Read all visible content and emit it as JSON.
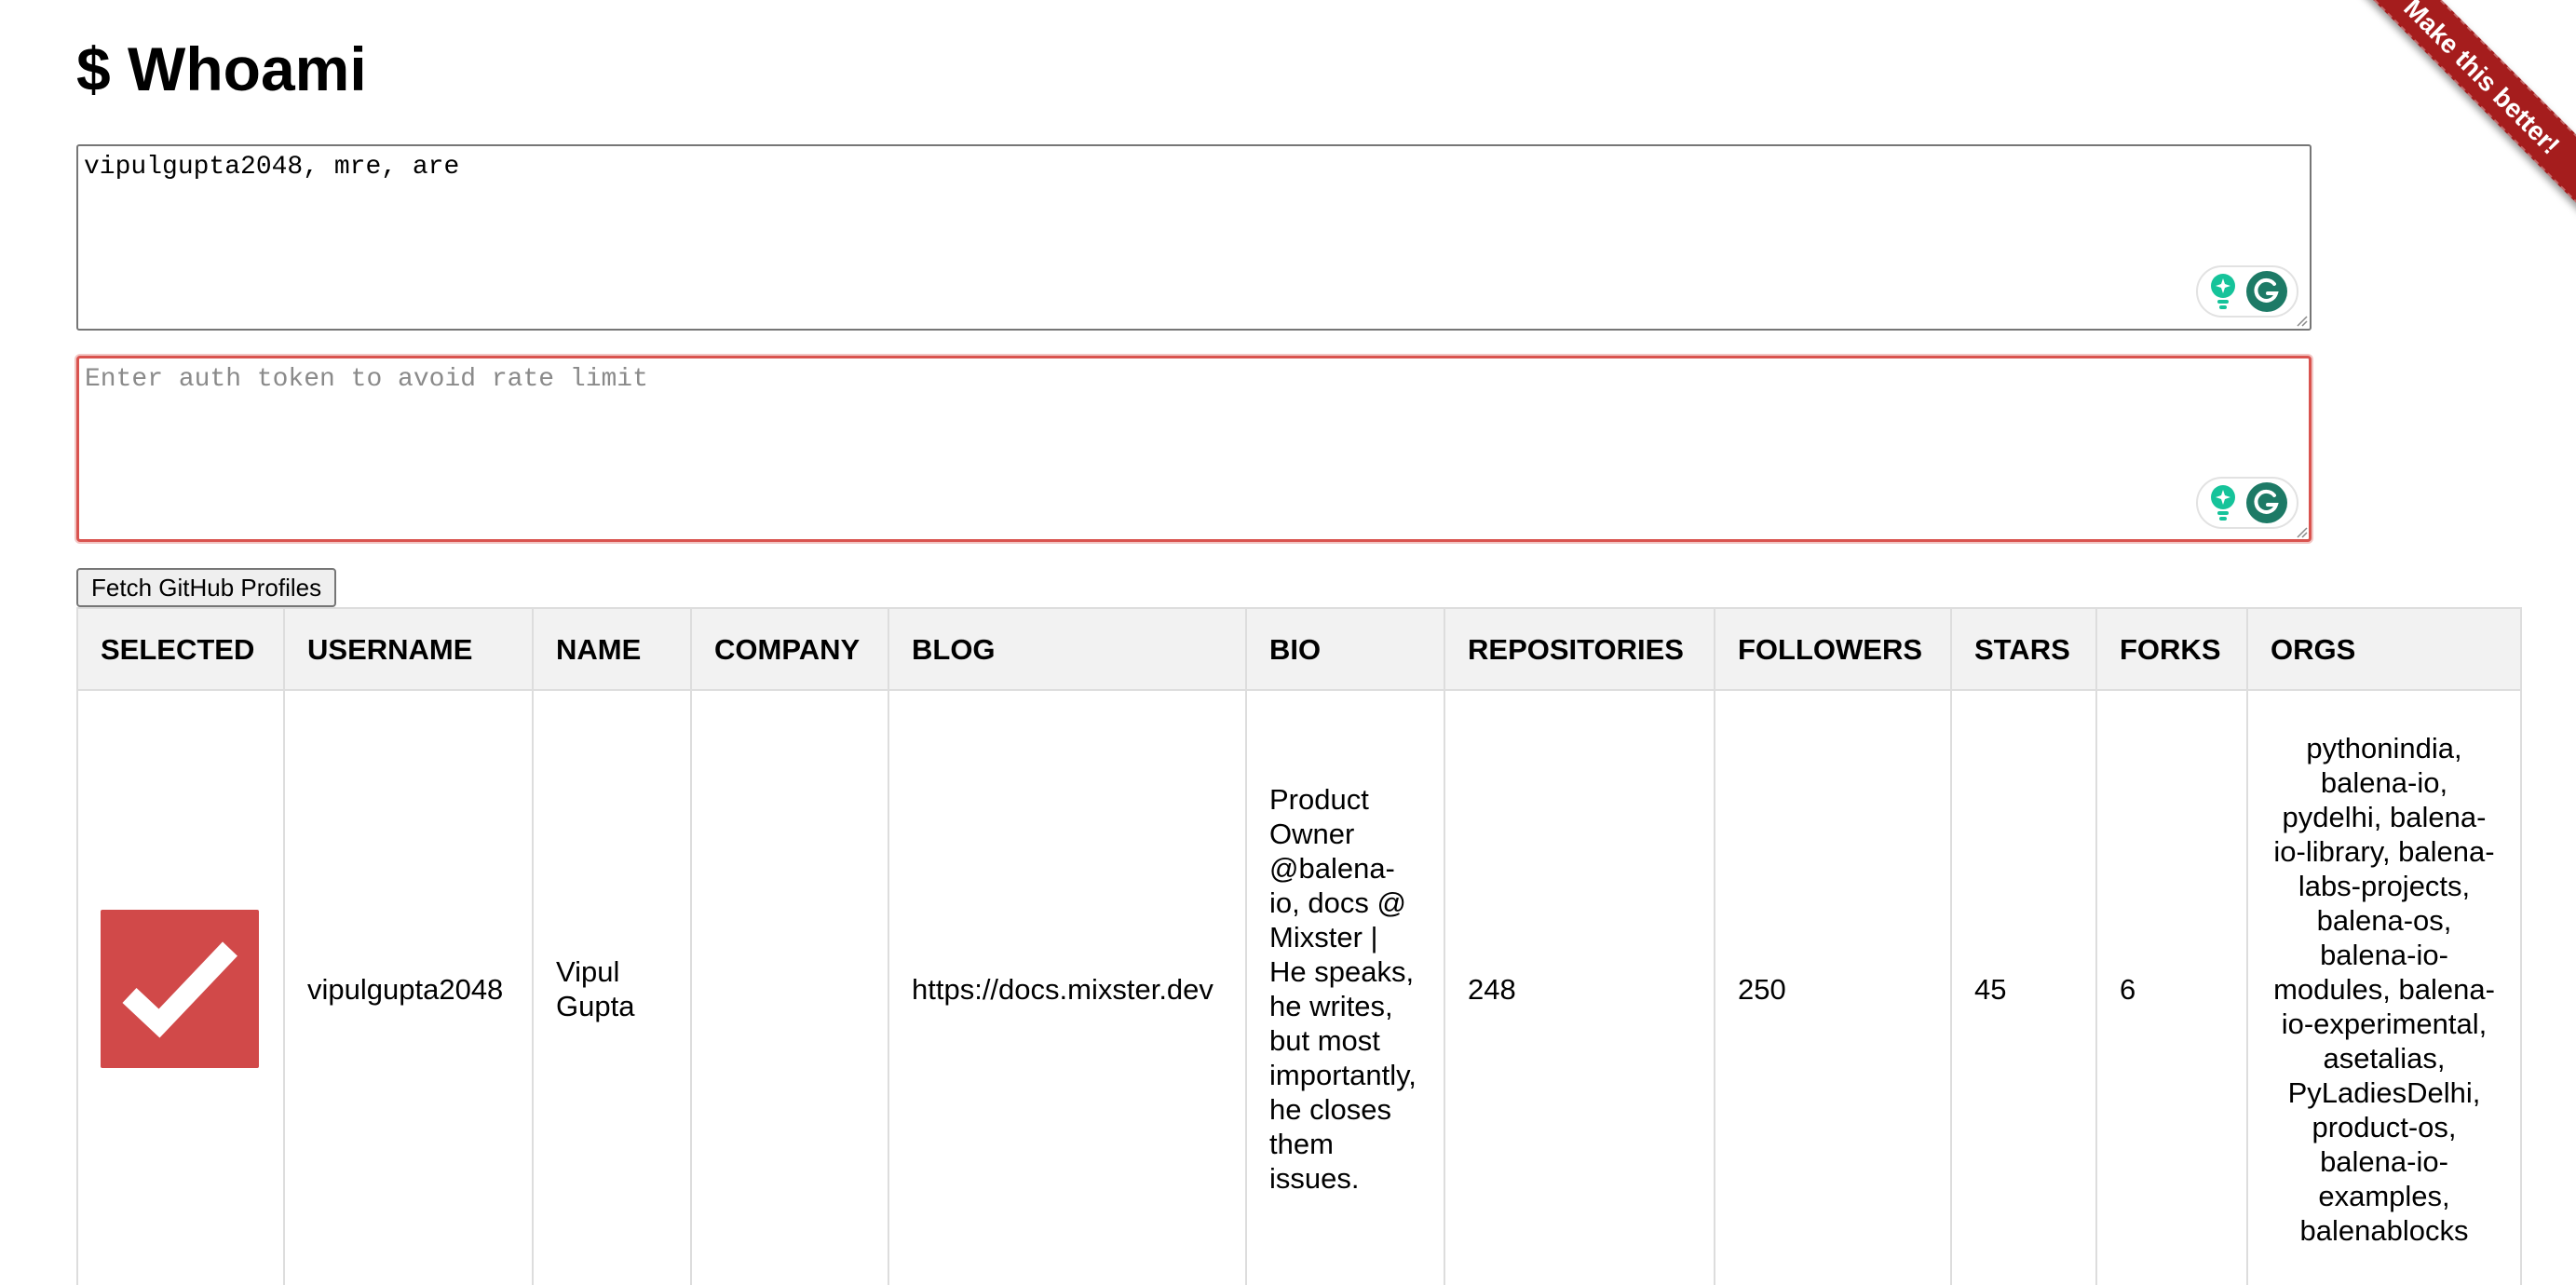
{
  "page": {
    "title": "$ Whoami"
  },
  "inputs": {
    "usernames_value": "vipulgupta2048, mre, are",
    "token_placeholder": "Enter auth token to avoid rate limit",
    "token_value": ""
  },
  "fetch_button_label": "Fetch GitHub Profiles",
  "ribbon_text": "Make this better!",
  "table": {
    "headers": [
      "SELECTED",
      "USERNAME",
      "NAME",
      "COMPANY",
      "BLOG",
      "BIO",
      "REPOSITORIES",
      "FOLLOWERS",
      "STARS",
      "FORKS",
      "ORGS"
    ],
    "rows": [
      {
        "selected": true,
        "username": "vipulgupta2048",
        "name": "Vipul Gupta",
        "company": "",
        "blog": "https://docs.mixster.dev",
        "bio": "Product Owner @balena-io, docs @ Mixster | He speaks, he writes, but most importantly, he closes them issues.",
        "repositories": "248",
        "followers": "250",
        "stars": "45",
        "forks": "6",
        "orgs": "pythonindia, balena-io, pydelhi, balena-io-library, balena-labs-projects, balena-os, balena-io-modules, balena-io-experimental, asetalias, PyLadiesDelhi, product-os, balena-io-examples, balenablocks"
      }
    ]
  },
  "colors": {
    "accent_red": "#d14949",
    "ribbon_red": "#a51d1d",
    "grammarly_green": "#15c39a"
  },
  "icons": {
    "checkmark": "check-icon",
    "grammarly": "grammarly-icon",
    "grammarly_bulb": "lightbulb-icon"
  }
}
